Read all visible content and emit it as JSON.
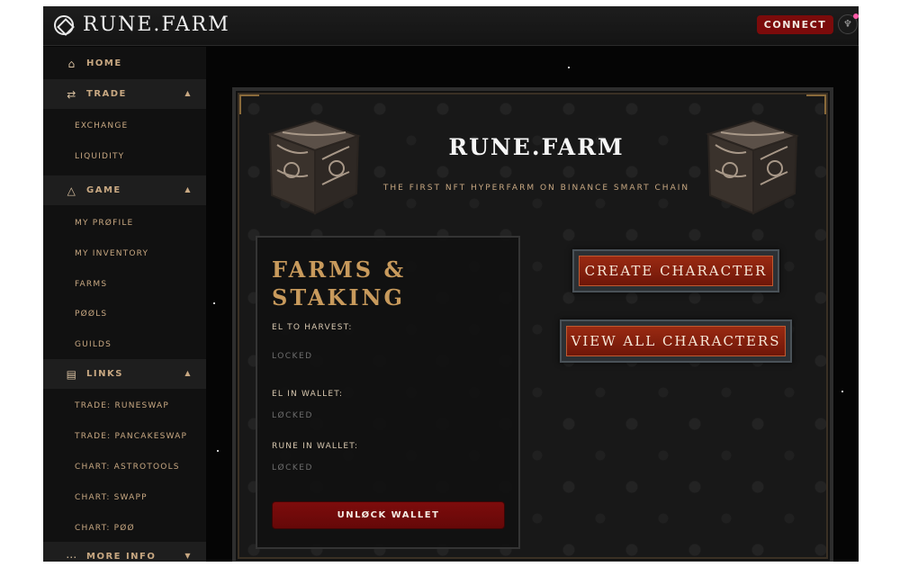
{
  "header": {
    "logo_text": "RUNE.FARM",
    "connect_label": "CONNECT"
  },
  "sidebar": {
    "home": "HOME",
    "trade": "TRADE",
    "trade_items": [
      "EXCHANGE",
      "LIQUIDITY"
    ],
    "game": "GAME",
    "game_items": [
      "MY PRØFILE",
      "MY INVENTORY",
      "FARMS",
      "PØØLS",
      "GUILDS"
    ],
    "links": "LINKS",
    "links_items": [
      "TRADE: RUNESWAP",
      "TRADE: PANCAKESWAP",
      "CHART: ASTROTOOLS",
      "CHART: SWAPP",
      "CHART: PØØ"
    ],
    "more_info": "MORE INFO"
  },
  "main": {
    "title": "RUNE.FARM",
    "subtitle": "THE FIRST NFT HYPERFARM ON BINANCE SMART CHAIN",
    "farms": {
      "title": "FARMS & STAKING",
      "el_to_harvest_label": "EL TO HARVEST:",
      "el_to_harvest_value": "LOCKED",
      "el_in_wallet_label": "EL IN WALLET:",
      "el_in_wallet_value": "LØCKED",
      "rune_in_wallet_label": "RUNE IN WALLET:",
      "rune_in_wallet_value": "LØCKED",
      "unlock_label": "UNLØCK WALLET"
    },
    "create_character_label": "CREATE CHARACTER",
    "view_all_characters_label": "VIEW ALL CHARACTERS"
  },
  "colors": {
    "accent_red": "#7b0b0b",
    "gold": "#c89a5c",
    "sidebar_text": "#c8a882"
  }
}
